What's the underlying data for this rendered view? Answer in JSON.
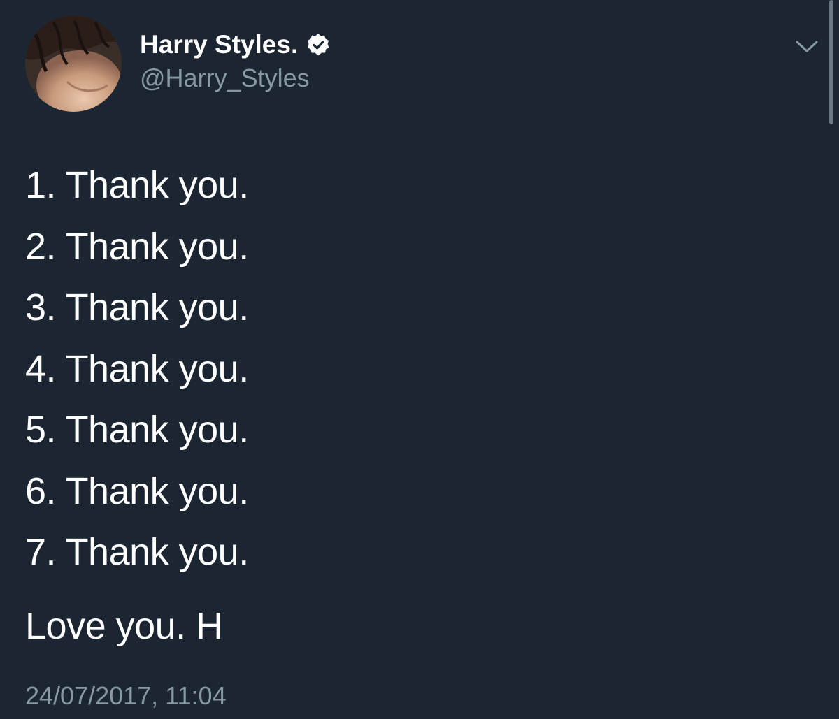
{
  "tweet": {
    "author": {
      "display_name": "Harry Styles.",
      "handle": "@Harry_Styles",
      "verified": true,
      "avatar": "profile-photo"
    },
    "menu_icon": "chevron-down-icon",
    "verified_icon": "verified-badge-icon",
    "lines": [
      "1. Thank you.",
      "2. Thank you.",
      "3. Thank you.",
      "4. Thank you.",
      "5. Thank you.",
      "6. Thank you.",
      "7. Thank you."
    ],
    "signoff": "Love you. H",
    "timestamp": "24/07/2017, 11:04"
  },
  "colors": {
    "background": "#1c2633",
    "primary_text": "#ffffff",
    "secondary_text": "#8899a6"
  }
}
